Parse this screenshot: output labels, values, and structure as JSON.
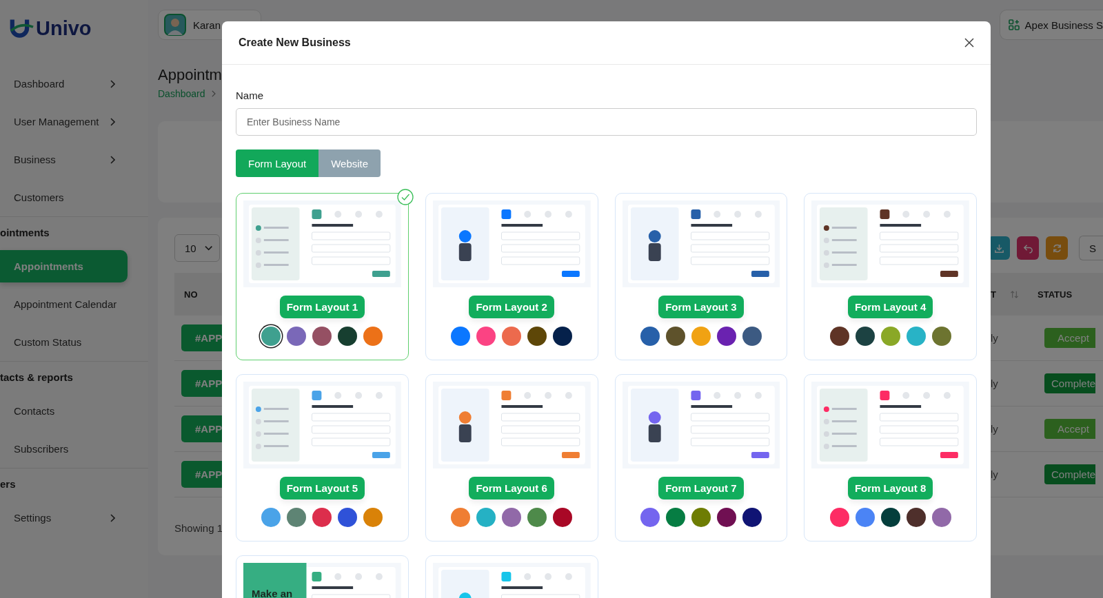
{
  "sidebar": {
    "logo": "Univo",
    "items": [
      {
        "kind": "link",
        "label": "Dashboard",
        "chevron": true,
        "selected": false
      },
      {
        "kind": "link",
        "label": "User Management",
        "chevron": true,
        "selected": false
      },
      {
        "kind": "link",
        "label": "Business",
        "chevron": true,
        "selected": false
      },
      {
        "kind": "link",
        "label": "Customers",
        "chevron": false,
        "selected": false
      },
      {
        "kind": "section",
        "label": "ointments"
      },
      {
        "kind": "link",
        "label": "Appointments",
        "chevron": false,
        "selected": true
      },
      {
        "kind": "link",
        "label": "Appointment Calendar",
        "chevron": false,
        "selected": false
      },
      {
        "kind": "link",
        "label": "Custom Status",
        "chevron": false,
        "selected": false
      },
      {
        "kind": "section",
        "label": "tacts & reports"
      },
      {
        "kind": "link",
        "label": "Contacts",
        "chevron": false,
        "selected": false
      },
      {
        "kind": "link",
        "label": "Subscribers",
        "chevron": false,
        "selected": false
      },
      {
        "kind": "section",
        "label": "ers"
      },
      {
        "kind": "link",
        "label": "Settings",
        "chevron": true,
        "selected": false
      }
    ]
  },
  "header": {
    "user": "Karan",
    "business": "Apex Business S"
  },
  "page": {
    "title": "Appointm",
    "breadcrumb": "Dashboard"
  },
  "table": {
    "page_size": "10",
    "search": "S",
    "columns": [
      "NO",
      "T",
      "STATUS"
    ],
    "rows": [
      {
        "no": "#APP",
        "column_2": "ly",
        "status": "Accept",
        "kind": "accept"
      },
      {
        "no": "#APP",
        "column_2": "ly",
        "status": "Complete",
        "kind": "complete"
      },
      {
        "no": "#APP",
        "column_2": "ly",
        "status": "Accept",
        "kind": "accept"
      },
      {
        "no": "#APP",
        "column_2": "ly",
        "status": "Complete",
        "kind": "complete"
      }
    ],
    "footer": "Showing 1"
  },
  "modal": {
    "title": "Create New Business",
    "name_field": {
      "label": "Name",
      "placeholder": "Enter Business Name"
    },
    "tabs": [
      {
        "label": "Form Layout",
        "selected": true
      },
      {
        "label": "Website",
        "selected": false
      }
    ],
    "layouts": [
      {
        "label": "Form Layout 1",
        "selected": true,
        "color": "#3fa08f",
        "swatches": [
          {
            "color": "#3fa08f",
            "selected": true
          },
          {
            "color": "#7a68b8",
            "selected": false
          },
          {
            "color": "#955063",
            "selected": false
          },
          {
            "color": "#173f30",
            "selected": false
          },
          {
            "color": "#ec7118",
            "selected": false
          }
        ]
      },
      {
        "label": "Form Layout 2",
        "selected": false,
        "color": "#0b77ff",
        "swatches": [
          {
            "color": "#0b77ff",
            "selected": false
          },
          {
            "color": "#fb4383",
            "selected": false
          },
          {
            "color": "#ec6a4d",
            "selected": false
          },
          {
            "color": "#5e4708",
            "selected": false
          },
          {
            "color": "#05214b",
            "selected": false
          }
        ]
      },
      {
        "label": "Form Layout 3",
        "selected": false,
        "color": "#2760a9",
        "swatches": [
          {
            "color": "#2760a9",
            "selected": false
          },
          {
            "color": "#5e522b",
            "selected": false
          },
          {
            "color": "#f0a213",
            "selected": false
          },
          {
            "color": "#6a22b0",
            "selected": false
          },
          {
            "color": "#3c5a82",
            "selected": false
          }
        ]
      },
      {
        "label": "Form Layout 4",
        "selected": false,
        "color": "#5f3426",
        "swatches": [
          {
            "color": "#5f3426",
            "selected": false
          },
          {
            "color": "#1c4242",
            "selected": false
          },
          {
            "color": "#8aa827",
            "selected": false
          },
          {
            "color": "#28b3c6",
            "selected": false
          },
          {
            "color": "#6d7430",
            "selected": false
          }
        ]
      },
      {
        "label": "Form Layout 5",
        "selected": false,
        "color": "#4aa3e8",
        "swatches": [
          {
            "color": "#4aa3e8",
            "selected": false
          },
          {
            "color": "#5e8474",
            "selected": false
          },
          {
            "color": "#dc2e4c",
            "selected": false
          },
          {
            "color": "#2f52d8",
            "selected": false
          },
          {
            "color": "#d98208",
            "selected": false
          }
        ]
      },
      {
        "label": "Form Layout 6",
        "selected": false,
        "color": "#ef7e33",
        "swatches": [
          {
            "color": "#ef7e33",
            "selected": false
          },
          {
            "color": "#25b1c4",
            "selected": false
          },
          {
            "color": "#9169a8",
            "selected": false
          },
          {
            "color": "#4e8a4a",
            "selected": false
          },
          {
            "color": "#a90826",
            "selected": false
          }
        ]
      },
      {
        "label": "Form Layout 7",
        "selected": false,
        "color": "#7465ef",
        "swatches": [
          {
            "color": "#7465ef",
            "selected": false
          },
          {
            "color": "#067d43",
            "selected": false
          },
          {
            "color": "#6e7d03",
            "selected": false
          },
          {
            "color": "#700f52",
            "selected": false
          },
          {
            "color": "#101474",
            "selected": false
          }
        ]
      },
      {
        "label": "Form Layout 8",
        "selected": false,
        "color": "#fd2c64",
        "swatches": [
          {
            "color": "#fd2c64",
            "selected": false
          },
          {
            "color": "#4b84f5",
            "selected": false
          },
          {
            "color": "#043e3c",
            "selected": false
          },
          {
            "color": "#4e2f2b",
            "selected": false
          },
          {
            "color": "#9169a8",
            "selected": false
          }
        ]
      },
      {
        "selected": false,
        "color": "#36ae82",
        "preview_text": "Make an"
      },
      {
        "selected": false,
        "color": "#17c5ea"
      }
    ]
  }
}
